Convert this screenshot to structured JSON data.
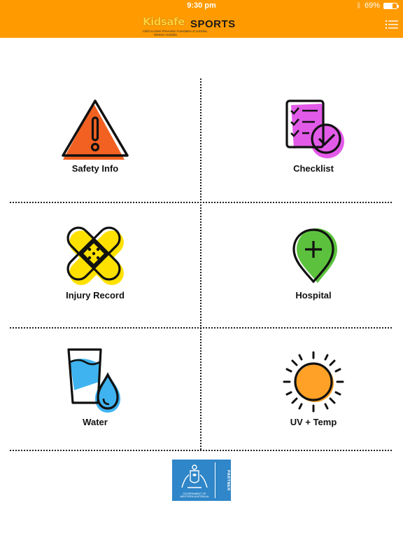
{
  "status_bar": {
    "time": "9:30 pm",
    "battery": "69%",
    "battery_fraction": 0.69
  },
  "header": {
    "logo_kid": "Kidsafe",
    "logo_sports": "SPORTS",
    "logo_subtitle": "Child Accident Prevention Foundation of Australia",
    "logo_region": "Western Australia"
  },
  "tiles": {
    "safety": {
      "label": "Safety Info",
      "icon": "warning-icon"
    },
    "checklist": {
      "label": "Checklist",
      "icon": "checklist-icon"
    },
    "injury": {
      "label": "Injury Record",
      "icon": "bandage-icon"
    },
    "hospital": {
      "label": "Hospital",
      "icon": "hospital-pin-icon"
    },
    "water": {
      "label": "Water",
      "icon": "water-glass-icon"
    },
    "uv": {
      "label": "UV + Temp",
      "icon": "sun-icon"
    }
  },
  "footer": {
    "partner_label": "PARTNER",
    "gov_line1": "GOVERNMENT OF",
    "gov_line2": "WESTERN AUSTRALIA"
  },
  "colors": {
    "header": "#ff9a00",
    "warning": "#f26122",
    "checklist": "#e25be8",
    "bandage": "#ffe100",
    "hospital": "#5cc23e",
    "water": "#3fb3f0",
    "sun": "#ffa126",
    "partner": "#2f86c8"
  }
}
